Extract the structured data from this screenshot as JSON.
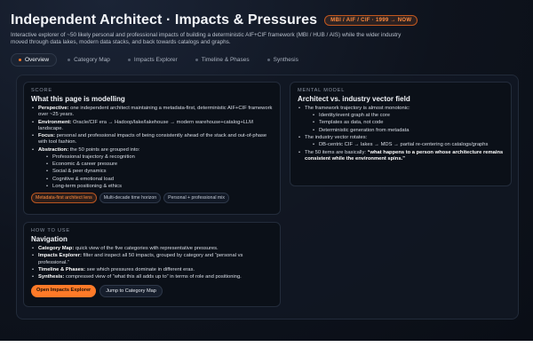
{
  "header": {
    "title": "Independent Architect · Impacts & Pressures",
    "badge": "MBI / AIF / CIF · 1999 → NOW",
    "subtitle": "Interactive explorer of ~50 likely personal and professional impacts of building a deterministic AIF+CIF framework (MBI / HUB / AIS) while the wider industry moved through data lakes, modern data stacks, and back towards catalogs and graphs."
  },
  "tabs": [
    {
      "label": "Overview",
      "active": true
    },
    {
      "label": "Category Map",
      "active": false
    },
    {
      "label": "Impacts Explorer",
      "active": false
    },
    {
      "label": "Timeline & Phases",
      "active": false
    },
    {
      "label": "Synthesis",
      "active": false
    }
  ],
  "score": {
    "kicker": "SCORE",
    "title": "What this page is modelling",
    "items": [
      {
        "key": "Perspective:",
        "text": " one independent architect maintaining a metadata-first, deterministic AIF+CIF framework over ~25 years."
      },
      {
        "key": "Environment:",
        "text": " Oracle/CIF era → Hadoop/lake/lakehouse → modern warehouse+catalog+LLM landscape."
      },
      {
        "key": "Focus:",
        "text": " personal and professional impacts of being consistently ahead of the stack and out-of-phase with tool fashion."
      },
      {
        "key": "Abstraction:",
        "text": " the 50 points are grouped into:"
      }
    ],
    "groups": [
      "Professional trajectory & recognition",
      "Economic & career pressure",
      "Social & peer dynamics",
      "Cognitive & emotional load",
      "Long-term positioning & ethics"
    ],
    "chips": [
      "Metadata-first architect lens",
      "Multi-decade time horizon",
      "Personal + professional mix"
    ]
  },
  "mental": {
    "kicker": "MENTAL MODEL",
    "title": "Architect vs. industry vector field",
    "item1": "The framework trajectory is almost monotonic:",
    "sub1": [
      "Identity/event graph at the core",
      "Templates as data, not code",
      "Deterministic generation from metadata"
    ],
    "item2": "The industry vector rotates:",
    "sub2": [
      "DB-centric CIF → lakes → MDS → partial re-centering on catalogs/graphs"
    ],
    "item3_text": "The 50 items are basically: ",
    "item3_bold": "“what happens to a person whose architecture remains consistent while the environment spins.”"
  },
  "howto": {
    "kicker": "HOW TO USE",
    "title": "Navigation",
    "items": [
      {
        "key": "Category Map:",
        "text": " quick view of the five categories with representative pressures."
      },
      {
        "key": "Impacts Explorer:",
        "text": " filter and inspect all 50 impacts, grouped by category and “personal vs professional.”"
      },
      {
        "key": "Timeline & Phases:",
        "text": " see which pressures dominate in different eras."
      },
      {
        "key": "Synthesis:",
        "text": " compressed view of “what this all adds up to” in terms of role and positioning."
      }
    ],
    "btn_primary": "Open Impacts Explorer",
    "btn_secondary": "Jump to Category Map"
  },
  "colors": {
    "accent": "#ff7a28",
    "background": "#0e131d",
    "card": "#0b1018"
  }
}
